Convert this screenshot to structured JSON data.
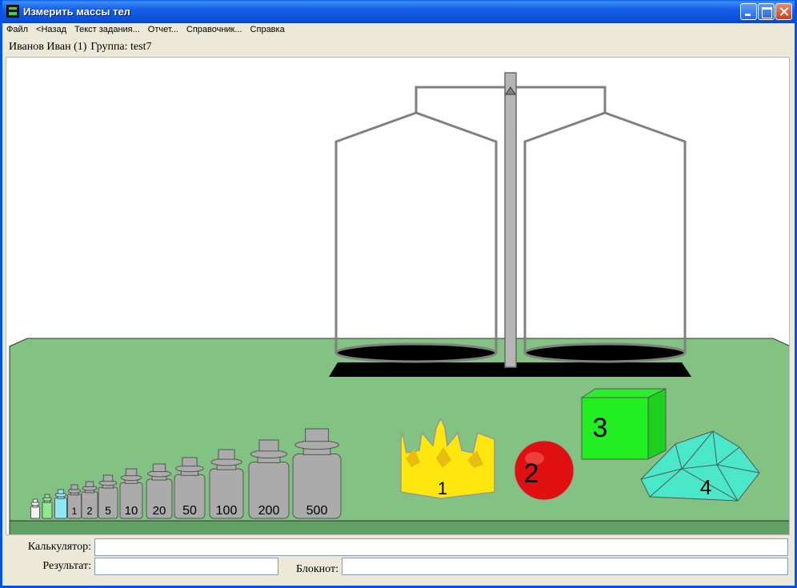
{
  "window": {
    "title": "Измерить массы тел"
  },
  "menu": {
    "file": "Файл",
    "back": "<Назад",
    "task": "Текст задания...",
    "report": "Отчет...",
    "handbook": "Справочник...",
    "help": "Справка"
  },
  "user": {
    "name": "Иванов Иван (1)",
    "group": "Группа: test7"
  },
  "weights": [
    "1",
    "2",
    "5",
    "10",
    "20",
    "50",
    "100",
    "200",
    "500"
  ],
  "objects": {
    "crown": "1",
    "ball": "2",
    "cube": "3",
    "crystal": "4"
  },
  "fields": {
    "calculator_label": "Калькулятор:",
    "calculator_value": "",
    "result_label": "Результат:",
    "result_value": "",
    "notepad_label": "Блокнот:",
    "notepad_value": ""
  },
  "colors": {
    "table": "#82c282",
    "table_front": "#63a063",
    "crown": "#fde70f",
    "ball": "#e01010",
    "cube": "#22ee22",
    "crystal": "#4ae8c8",
    "weight": "#ababab"
  }
}
